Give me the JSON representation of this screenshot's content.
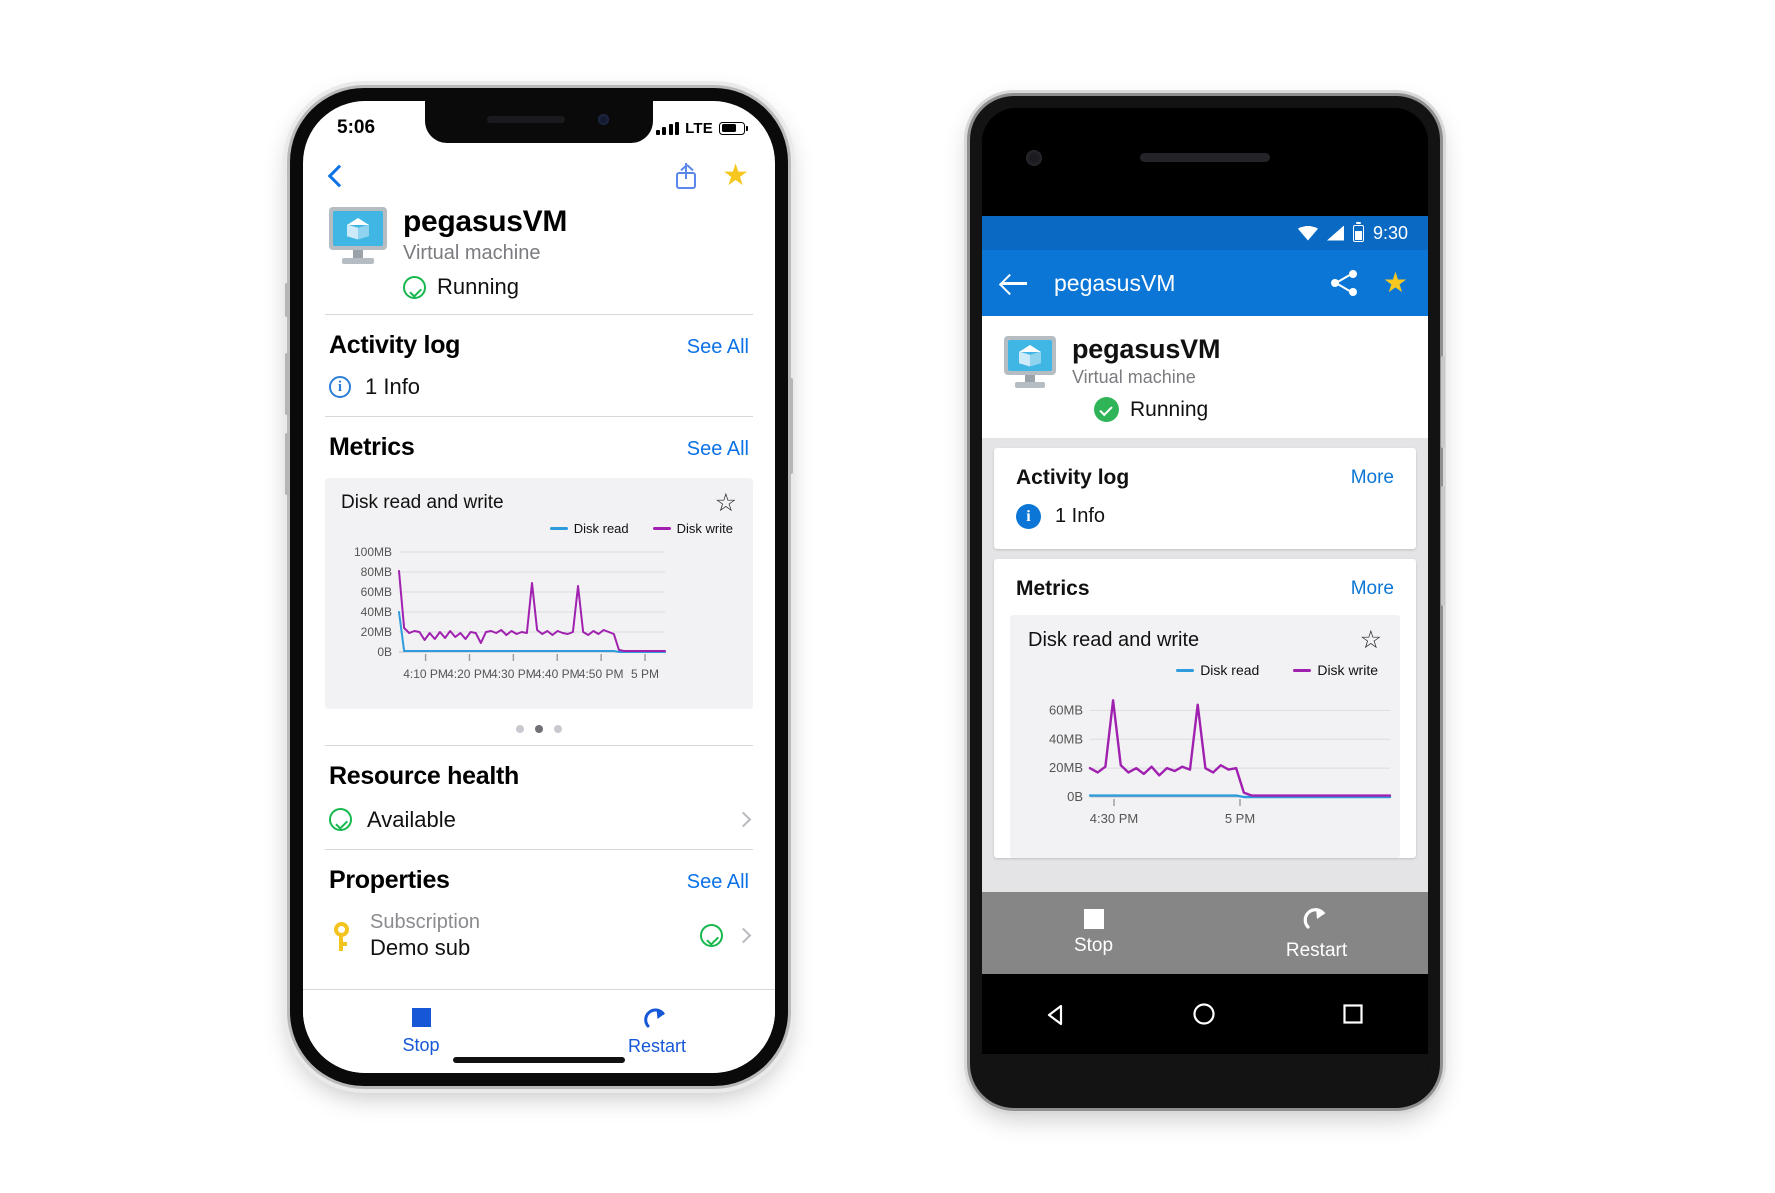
{
  "ios": {
    "status": {
      "time": "5:06",
      "carrier_tech": "LTE"
    },
    "nav": {
      "back_icon": "chevron-left-icon",
      "share_icon": "share-icon",
      "favorite_icon": "star-filled-icon"
    },
    "resource": {
      "name": "pegasusVM",
      "type": "Virtual machine",
      "status": "Running"
    },
    "activity": {
      "title": "Activity log",
      "action": "See All",
      "item": "1 Info",
      "info_glyph": "i"
    },
    "metrics": {
      "title": "Metrics",
      "action": "See All"
    },
    "health": {
      "title": "Resource health",
      "value": "Available"
    },
    "properties": {
      "title": "Properties",
      "action": "See All",
      "row_label": "Subscription",
      "row_value": "Demo sub"
    },
    "tabs": {
      "stop": "Stop",
      "restart": "Restart"
    },
    "pager": {
      "count": 3,
      "active": 1
    }
  },
  "android": {
    "status": {
      "time": "9:30"
    },
    "appbar": {
      "title": "pegasusVM",
      "back_icon": "arrow-left-icon",
      "share_icon": "share-android-icon",
      "favorite_icon": "star-filled-icon"
    },
    "resource": {
      "name": "pegasusVM",
      "type": "Virtual machine",
      "status": "Running"
    },
    "activity": {
      "title": "Activity log",
      "action": "More",
      "item": "1 Info",
      "info_glyph": "i"
    },
    "metrics": {
      "title": "Metrics",
      "action": "More"
    },
    "actions": {
      "stop": "Stop",
      "restart": "Restart"
    },
    "navbar": {
      "back": "nav-back-icon",
      "home": "nav-home-icon",
      "recents": "nav-recents-icon"
    }
  },
  "colors": {
    "ios_accent": "#0b72e8",
    "android_accent": "#0b76d6",
    "android_status": "#0a69c2",
    "disk_read": "#2e9bdc",
    "disk_write": "#a021b0",
    "running_green": "#16b84e",
    "star_gold": "#f6c81f"
  },
  "chart_data": [
    {
      "id": "ios-disk-chart",
      "type": "line",
      "title": "Disk read and write",
      "xlabel": "",
      "ylabel": "",
      "ylim": [
        0,
        100
      ],
      "ytick_labels": [
        "100MB",
        "80MB",
        "60MB",
        "40MB",
        "20MB",
        "0B"
      ],
      "ytick_values": [
        100,
        80,
        60,
        40,
        20,
        0
      ],
      "xtick_labels": [
        "4:10 PM",
        "4:20 PM",
        "4:30 PM",
        "4:40 PM",
        "4:50 PM",
        "5 PM"
      ],
      "grid": true,
      "legend_position": "top-right",
      "series": [
        {
          "name": "Disk read",
          "color": "#2e9bdc",
          "values": [
            40,
            1,
            1,
            1,
            1,
            1,
            1,
            1,
            1,
            1,
            1,
            1,
            1,
            1,
            1,
            1,
            1,
            1,
            1,
            1,
            1,
            1,
            1,
            1,
            1,
            1,
            1,
            1,
            1,
            1,
            1,
            1,
            1,
            1,
            1,
            1,
            1,
            1,
            1,
            1,
            1,
            1,
            1,
            0,
            0,
            0,
            0,
            0,
            0,
            0,
            0,
            0,
            0
          ]
        },
        {
          "name": "Disk write",
          "color": "#a021b0",
          "values": [
            81,
            24,
            19,
            21,
            20,
            12,
            19,
            13,
            20,
            14,
            21,
            15,
            19,
            13,
            20,
            19,
            9,
            20,
            21,
            19,
            22,
            17,
            21,
            18,
            20,
            19,
            69,
            22,
            18,
            21,
            17,
            21,
            19,
            18,
            20,
            66,
            20,
            17,
            21,
            18,
            22,
            20,
            18,
            2,
            1,
            1,
            1,
            1,
            1,
            1,
            1,
            1,
            1
          ]
        }
      ]
    },
    {
      "id": "android-disk-chart",
      "type": "line",
      "title": "Disk read and write",
      "xlabel": "",
      "ylabel": "",
      "ylim": [
        0,
        70
      ],
      "ytick_labels": [
        "60MB",
        "40MB",
        "20MB",
        "0B"
      ],
      "ytick_values": [
        60,
        40,
        20,
        0
      ],
      "xtick_labels": [
        "4:30 PM",
        "5 PM"
      ],
      "grid": true,
      "legend_position": "top-right",
      "series": [
        {
          "name": "Disk read",
          "color": "#2e9bdc",
          "values": [
            1,
            1,
            1,
            1,
            1,
            1,
            1,
            1,
            1,
            1,
            1,
            1,
            1,
            1,
            1,
            1,
            1,
            1,
            1,
            1,
            0,
            0,
            0,
            0,
            0,
            0,
            0,
            0,
            0,
            0,
            0,
            0,
            0,
            0,
            0,
            0,
            0,
            0,
            0,
            0
          ]
        },
        {
          "name": "Disk write",
          "color": "#a021b0",
          "values": [
            20,
            17,
            21,
            67,
            22,
            17,
            20,
            16,
            21,
            15,
            20,
            18,
            21,
            19,
            64,
            20,
            17,
            22,
            19,
            20,
            3,
            1,
            1,
            1,
            1,
            1,
            1,
            1,
            1,
            1,
            1,
            1,
            1,
            1,
            1,
            1,
            1,
            1,
            1,
            1
          ]
        }
      ]
    }
  ]
}
